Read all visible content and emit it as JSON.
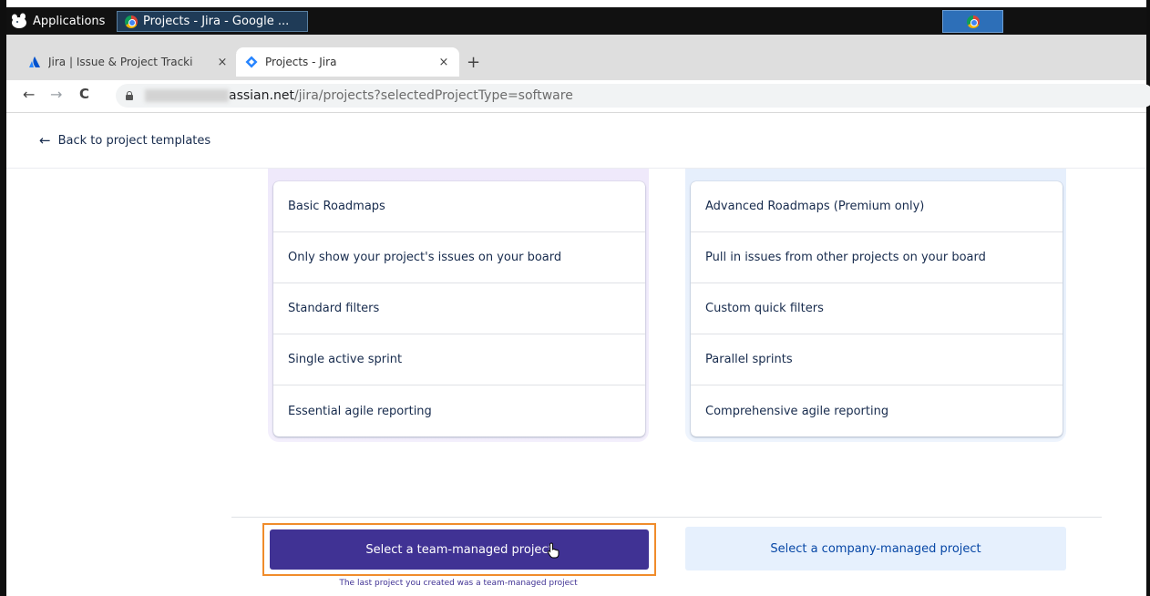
{
  "taskbar": {
    "applications_label": "Applications",
    "active_window_title": "Projects - Jira - Google ..."
  },
  "browser": {
    "tabs": [
      {
        "label": "Jira | Issue & Project Tracki",
        "close": "×"
      },
      {
        "label": "Projects - Jira",
        "close": "×"
      }
    ],
    "new_tab": "+",
    "url_host": "assian.net",
    "url_path": "/jira/projects?selectedProjectType=software"
  },
  "page": {
    "back_label": "Back to project templates",
    "left_features": [
      "Basic Roadmaps",
      "Only show your project's issues on your board",
      "Standard filters",
      "Single active sprint",
      "Essential agile reporting"
    ],
    "right_features": [
      "Advanced Roadmaps (Premium only)",
      "Pull in issues from other projects on your board",
      "Custom quick filters",
      "Parallel sprints",
      "Comprehensive agile reporting"
    ],
    "primary_button": "Select a team-managed project",
    "primary_hint": "The last project you created was a team-managed project",
    "secondary_button": "Select a company-managed project"
  },
  "colors": {
    "primary": "#403294",
    "secondary_bg": "#e6f0fd",
    "secondary_text": "#0747a6",
    "highlight": "#f08c2b"
  }
}
